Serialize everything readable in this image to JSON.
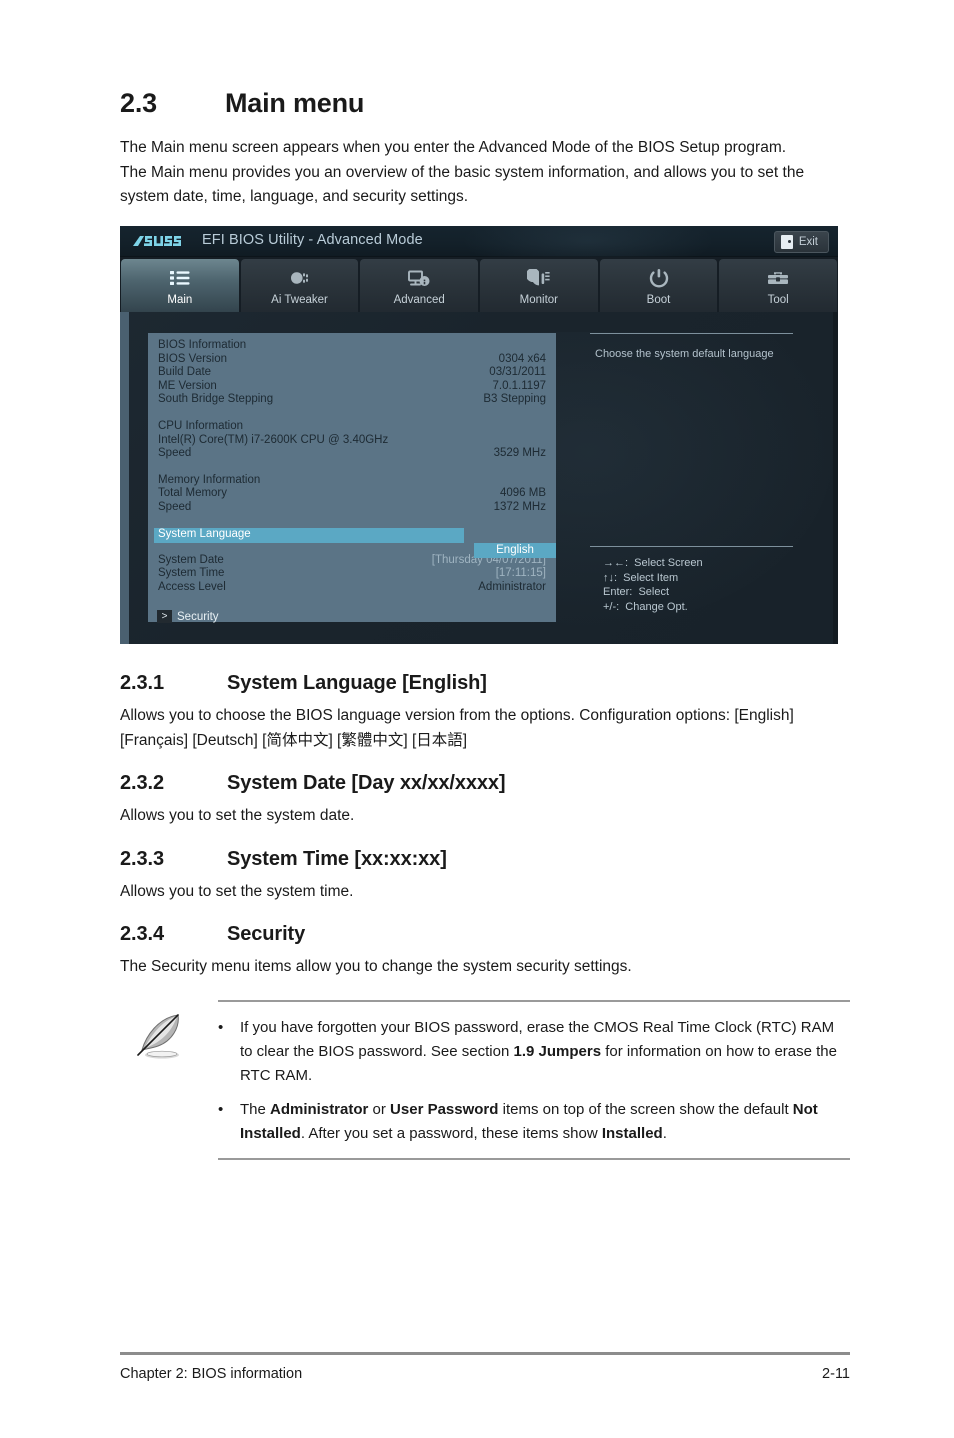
{
  "document": {
    "section_number": "2.3",
    "section_title": "Main menu",
    "intro": "The Main menu screen appears when you enter the Advanced Mode of the BIOS Setup program. The Main menu provides you an overview of the basic system information, and allows you to set the system date, time, language, and security settings."
  },
  "subsections": {
    "lang": {
      "num": "2.3.1",
      "title": "System Language [English]",
      "body_a": "Allows you to choose the BIOS language version from the options. Configuration options:",
      "body_b": "[English] [Français] [Deutsch] [简体中文] [繁體中文] [日本語]"
    },
    "date": {
      "num": "2.3.2",
      "title": "System Date [Day xx/xx/xxxx]",
      "body": "Allows you to set the system date."
    },
    "time": {
      "num": "2.3.3",
      "title": "System Time [xx:xx:xx]",
      "body": "Allows you to set the system time."
    },
    "security": {
      "num": "2.3.4",
      "title": "Security",
      "body": "The Security menu items allow you to change the system security settings."
    }
  },
  "note": {
    "icon": "feather-quill-icon",
    "bullet": "•",
    "items": [
      {
        "pre": "If you have forgotten your BIOS password, erase the CMOS Real Time Clock (RTC) RAM to clear the BIOS password. See section ",
        "bold": "1.9 Jumpers",
        "post": " for information on how to erase the RTC RAM."
      },
      {
        "p1": "The ",
        "b1": "Administrator",
        "p2": " or ",
        "b2": "User Password",
        "p3": " items on top of the screen show the default ",
        "b3": "Not Installed",
        "p4": ". After you set a password, these items show ",
        "b4": "Installed",
        "p5": "."
      }
    ]
  },
  "footer": {
    "left": "Chapter 2: BIOS information",
    "right": "2-11"
  },
  "bios": {
    "brand": "ASUS",
    "title": "EFI BIOS Utility - Advanced Mode",
    "exit_label": "Exit",
    "exit_icon": "exit-door-icon",
    "tabs": [
      {
        "label": "Main",
        "icon": "list-icon",
        "active": true
      },
      {
        "label": "Ai  Tweaker",
        "icon": "tweak-icon",
        "active": false
      },
      {
        "label": "Advanced",
        "icon": "monitor-info-icon",
        "active": false
      },
      {
        "label": "Monitor",
        "icon": "gauge-icon",
        "active": false
      },
      {
        "label": "Boot",
        "icon": "power-icon",
        "active": false
      },
      {
        "label": "Tool",
        "icon": "toolbox-icon",
        "active": false
      }
    ],
    "info": {
      "bios_heading": "BIOS Information",
      "rows_bios": [
        {
          "label": "BIOS Version",
          "value": "0304 x64"
        },
        {
          "label": "Build Date",
          "value": "03/31/2011"
        },
        {
          "label": "ME Version",
          "value": "7.0.1.1197"
        },
        {
          "label": "South Bridge Stepping",
          "value": "B3 Stepping"
        }
      ],
      "cpu_heading": "CPU Information",
      "cpu_name": "Intel(R) Core(TM) i7-2600K CPU @ 3.40GHz",
      "cpu_speed_label": "Speed",
      "cpu_speed_value": "3529 MHz",
      "mem_heading": "Memory Information",
      "rows_mem": [
        {
          "label": "Total Memory",
          "value": "4096 MB"
        },
        {
          "label": "Speed",
          "value": "1372 MHz"
        }
      ],
      "lang_label": "System Language",
      "lang_value": "English",
      "rows_sys": [
        {
          "label": "System Date",
          "value": "[Thursday 04/07/2011]"
        },
        {
          "label": "System Time",
          "value": "[17:11:15]"
        },
        {
          "label": "Access Level",
          "value": "Administrator"
        }
      ],
      "security_arrow": ">",
      "security_label": "Security"
    },
    "help": {
      "text": "Choose the system default language",
      "legend": [
        "→←:  Select Screen",
        "↑↓:  Select Item",
        "Enter:  Select",
        "+/-:  Change Opt."
      ]
    },
    "colors": {
      "highlight": "#5ba8c4",
      "panel": "#5b7486",
      "chrome": "#1d242b",
      "title_text": "#b9ccd8"
    }
  }
}
